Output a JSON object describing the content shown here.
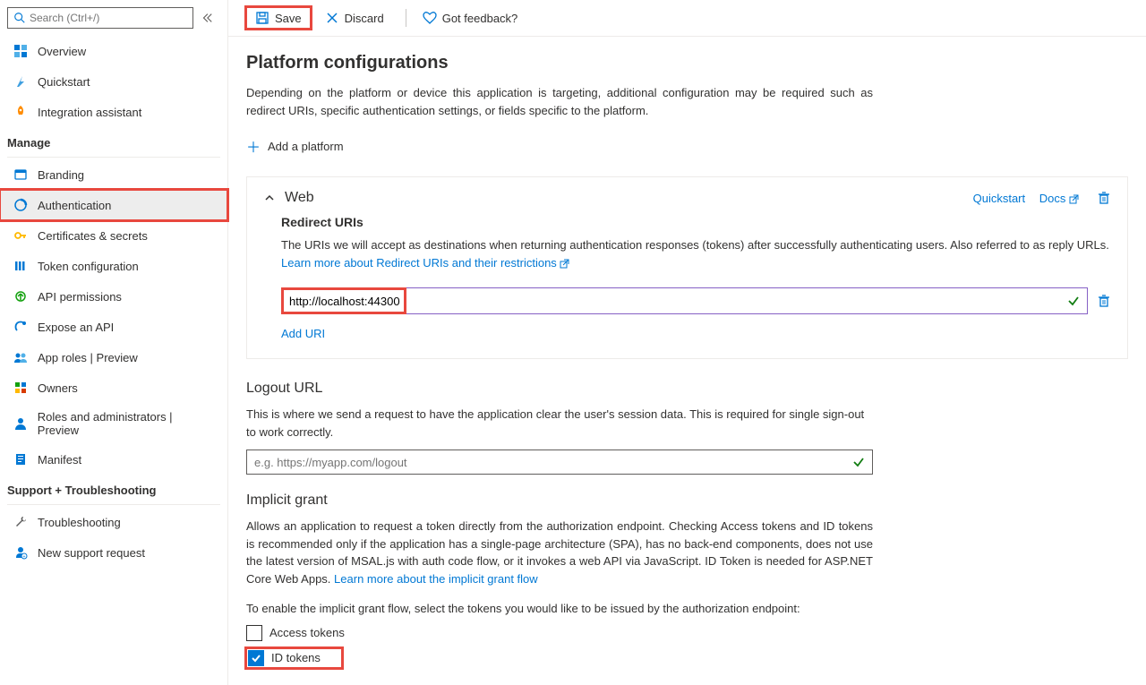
{
  "search": {
    "placeholder": "Search (Ctrl+/)"
  },
  "sidebar": {
    "overview_items": [
      {
        "label": "Overview",
        "icon": "overview",
        "color": "#0078d4"
      },
      {
        "label": "Quickstart",
        "icon": "quickstart",
        "color": "#0078d4"
      },
      {
        "label": "Integration assistant",
        "icon": "rocket",
        "color": "#ff8c00"
      }
    ],
    "manage_label": "Manage",
    "manage_items": [
      {
        "label": "Branding",
        "icon": "branding",
        "color": "#0078d4"
      },
      {
        "label": "Authentication",
        "icon": "auth",
        "color": "#0078d4",
        "selected": true,
        "highlighted": true
      },
      {
        "label": "Certificates & secrets",
        "icon": "key",
        "color": "#ffb900"
      },
      {
        "label": "Token configuration",
        "icon": "token",
        "color": "#0078d4"
      },
      {
        "label": "API permissions",
        "icon": "api-perm",
        "color": "#13a10e"
      },
      {
        "label": "Expose an API",
        "icon": "expose",
        "color": "#0078d4"
      },
      {
        "label": "App roles | Preview",
        "icon": "roles",
        "color": "#0078d4"
      },
      {
        "label": "Owners",
        "icon": "owners",
        "color": "#0078d4"
      },
      {
        "label": "Roles and administrators | Preview",
        "icon": "admins",
        "color": "#0078d4"
      },
      {
        "label": "Manifest",
        "icon": "manifest",
        "color": "#0078d4"
      }
    ],
    "support_label": "Support + Troubleshooting",
    "support_items": [
      {
        "label": "Troubleshooting",
        "icon": "wrench",
        "color": "#5c5c5c"
      },
      {
        "label": "New support request",
        "icon": "support",
        "color": "#0078d4"
      }
    ]
  },
  "toolbar": {
    "save_label": "Save",
    "discard_label": "Discard",
    "feedback_label": "Got feedback?"
  },
  "platform_config": {
    "heading": "Platform configurations",
    "desc": "Depending on the platform or device this application is targeting, additional configuration may be required such as redirect URIs, specific authentication settings, or fields specific to the platform.",
    "add_platform": "Add a platform"
  },
  "web_panel": {
    "title": "Web",
    "quickstart": "Quickstart",
    "docs": "Docs",
    "redirect_heading": "Redirect URIs",
    "redirect_desc": "The URIs we will accept as destinations when returning authentication responses (tokens) after successfully authenticating users. Also referred to as reply URLs. ",
    "redirect_link": "Learn more about Redirect URIs and their restrictions",
    "uri_value": "http://localhost:44300",
    "add_uri": "Add URI"
  },
  "logout": {
    "heading": "Logout URL",
    "desc": "This is where we send a request to have the application clear the user's session data. This is required for single sign-out to work correctly.",
    "placeholder": "e.g. https://myapp.com/logout"
  },
  "implicit": {
    "heading": "Implicit grant",
    "desc": "Allows an application to request a token directly from the authorization endpoint. Checking Access tokens and ID tokens is recommended only if the application has a single-page architecture (SPA), has no back-end components, does not use the latest version of MSAL.js with auth code flow, or it invokes a web API via JavaScript. ID Token is needed for ASP.NET Core Web Apps. ",
    "link": "Learn more about the implicit grant flow",
    "enable_text": "To enable the implicit grant flow, select the tokens you would like to be issued by the authorization endpoint:",
    "access_tokens": "Access tokens",
    "id_tokens": "ID tokens"
  }
}
